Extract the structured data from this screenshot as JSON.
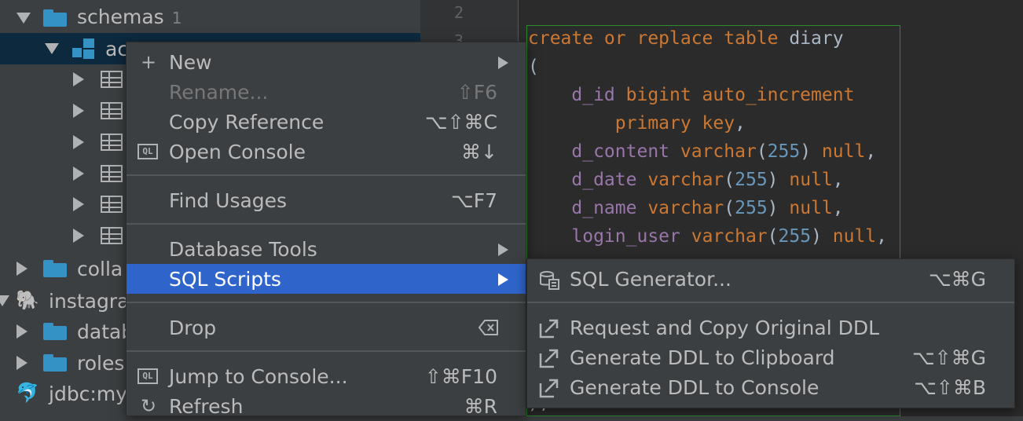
{
  "tree": {
    "rows": [
      {
        "label": "schemas",
        "count": "1"
      },
      {
        "label": "ac"
      },
      {
        "label": ""
      },
      {
        "label": ""
      },
      {
        "label": ""
      },
      {
        "label": ""
      },
      {
        "label": ""
      },
      {
        "label": ""
      },
      {
        "label": "colla"
      },
      {
        "label": "instagra"
      },
      {
        "label": "datab"
      },
      {
        "label": "roles"
      },
      {
        "label": "jdbc:my"
      }
    ]
  },
  "editor": {
    "line_numbers": [
      "2",
      "3"
    ],
    "code": [
      [
        [
          "kw",
          "create or replace table "
        ],
        [
          "id",
          "diary"
        ]
      ],
      [
        [
          "pn",
          "("
        ]
      ],
      [
        [
          "col",
          "    d_id "
        ],
        [
          "kw",
          "bigint auto_increment"
        ]
      ],
      [
        [
          "kw",
          "        primary key"
        ],
        [
          "pn",
          ","
        ]
      ],
      [
        [
          "col",
          "    d_content "
        ],
        [
          "kw",
          "varchar"
        ],
        [
          "pn",
          "("
        ],
        [
          "num",
          "255"
        ],
        [
          "pn",
          ") "
        ],
        [
          "kw",
          "null"
        ],
        [
          "pn",
          ","
        ]
      ],
      [
        [
          "col",
          "    d_date "
        ],
        [
          "kw",
          "varchar"
        ],
        [
          "pn",
          "("
        ],
        [
          "num",
          "255"
        ],
        [
          "pn",
          ") "
        ],
        [
          "kw",
          "null"
        ],
        [
          "pn",
          ","
        ]
      ],
      [
        [
          "col",
          "    d_name "
        ],
        [
          "kw",
          "varchar"
        ],
        [
          "pn",
          "("
        ],
        [
          "num",
          "255"
        ],
        [
          "pn",
          ") "
        ],
        [
          "kw",
          "null"
        ],
        [
          "pn",
          ","
        ]
      ],
      [
        [
          "col",
          "    login_user "
        ],
        [
          "kw",
          "varchar"
        ],
        [
          "pn",
          "("
        ],
        [
          "num",
          "255"
        ],
        [
          "pn",
          ") "
        ],
        [
          "kw",
          "null"
        ],
        [
          "pn",
          ","
        ]
      ]
    ],
    "trailing": ");"
  },
  "context_menu": {
    "new": {
      "label": "New"
    },
    "rename": {
      "label": "Rename...",
      "shortcut": "⇧F6"
    },
    "copy_reference": {
      "label": "Copy Reference",
      "shortcut": "⌥⇧⌘C"
    },
    "open_console": {
      "label": "Open Console",
      "shortcut": "⌘↓",
      "icon_text": "QL"
    },
    "find_usages": {
      "label": "Find Usages",
      "shortcut": "⌥F7"
    },
    "database_tools": {
      "label": "Database Tools"
    },
    "sql_scripts": {
      "label": "SQL Scripts"
    },
    "drop": {
      "label": "Drop"
    },
    "jump_to_console": {
      "label": "Jump to Console...",
      "shortcut": "⇧⌘F10",
      "icon_text": "QL"
    },
    "refresh": {
      "label": "Refresh",
      "shortcut": "⌘R"
    }
  },
  "sql_scripts_submenu": {
    "sql_generator": {
      "label": "SQL Generator...",
      "shortcut": "⌥⌘G"
    },
    "request_copy_ddl": {
      "label": "Request and Copy Original DDL"
    },
    "ddl_to_clipboard": {
      "label": "Generate DDL to Clipboard",
      "shortcut": "⌥⇧⌘G"
    },
    "ddl_to_console": {
      "label": "Generate DDL to Console",
      "shortcut": "⌥⇧⌘B"
    }
  },
  "colors": {
    "menu_bg": "#3c3f41",
    "selection": "#2f65ca",
    "tree_selection": "#0d293e",
    "editor_bg": "#2b2b2b",
    "keyword": "#cc7832",
    "column": "#9876aa",
    "number": "#6897bb"
  }
}
